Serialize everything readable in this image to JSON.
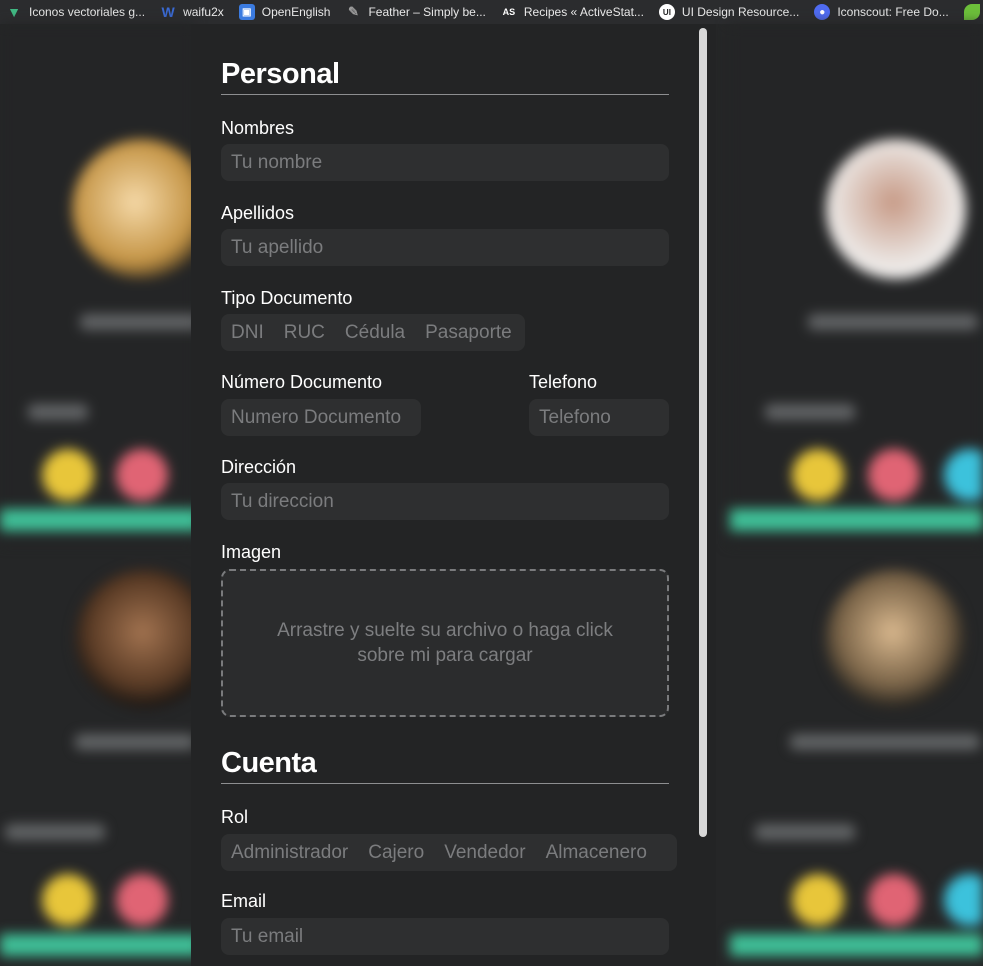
{
  "bookmarks": [
    {
      "label": "Iconos vectoriales g...",
      "icon": "vue-icon",
      "color": "#41b883"
    },
    {
      "label": "waifu2x",
      "icon": "w-icon",
      "color": "#3a6ad4"
    },
    {
      "label": "OpenEnglish",
      "icon": "openenglish-icon",
      "color": "#3b7be0"
    },
    {
      "label": "Feather – Simply be...",
      "icon": "feather-icon",
      "color": "#555555"
    },
    {
      "label": "Recipes « ActiveStat...",
      "icon": "activestate-icon",
      "color": "#444444"
    },
    {
      "label": "UI Design Resource...",
      "icon": "ui-icon",
      "color": "#333333"
    },
    {
      "label": "Iconscout: Free Do...",
      "icon": "iconscout-icon",
      "color": "#4f6bf0"
    },
    {
      "label": "",
      "icon": "leaf-icon",
      "color": "#6cbf3a"
    }
  ],
  "form": {
    "personal_title": "Personal",
    "nombres_label": "Nombres",
    "nombres_placeholder": "Tu nombre",
    "apellidos_label": "Apellidos",
    "apellidos_placeholder": "Tu apellido",
    "tipo_doc_label": "Tipo Documento",
    "tipo_doc_options": [
      "DNI",
      "RUC",
      "Cédula",
      "Pasaporte"
    ],
    "num_doc_label": "Número Documento",
    "num_doc_placeholder": "Numero Documento",
    "telefono_label": "Telefono",
    "telefono_placeholder": "Telefono",
    "direccion_label": "Dirección",
    "direccion_placeholder": "Tu direccion",
    "imagen_label": "Imagen",
    "imagen_drop_text": "Arrastre y suelte su archivo o haga click sobre mi para cargar",
    "cuenta_title": "Cuenta",
    "rol_label": "Rol",
    "rol_options": [
      "Administrador",
      "Cajero",
      "Vendedor",
      "Almacenero"
    ],
    "email_label": "Email",
    "email_placeholder": "Tu email"
  },
  "colors": {
    "accent_bar": "#3fbf97",
    "dot_yellow": "#e8c63a",
    "dot_red": "#e06474",
    "dot_cyan": "#3cc2dc"
  }
}
